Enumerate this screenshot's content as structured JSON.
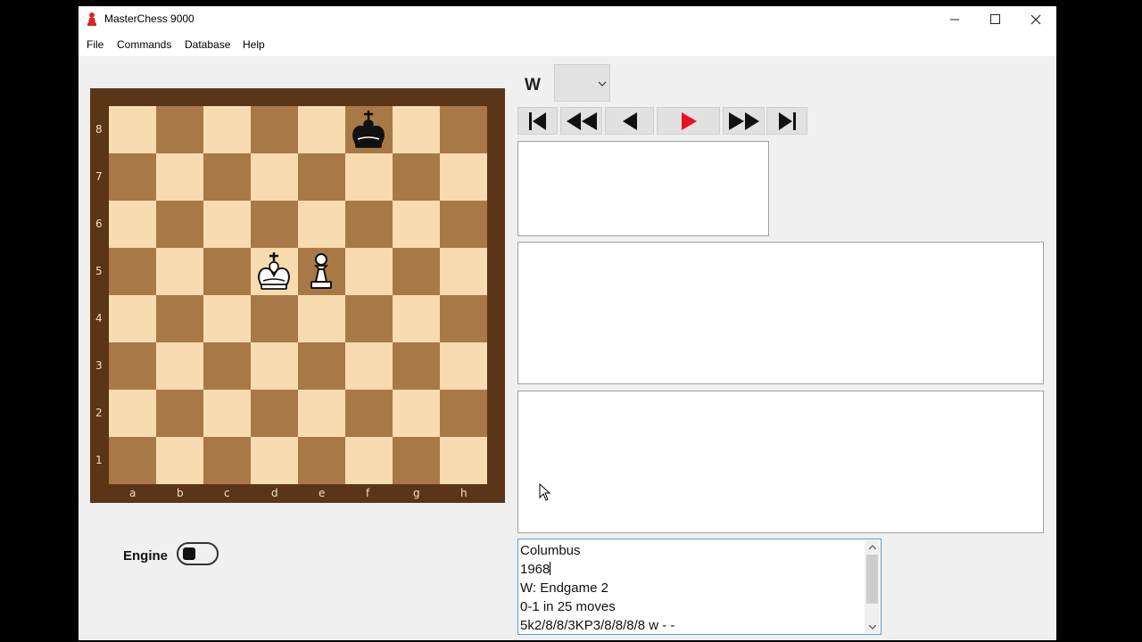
{
  "window": {
    "title": "MasterChess 9000",
    "controls": [
      "minimize",
      "maximize",
      "close"
    ]
  },
  "menu": [
    "File",
    "Commands",
    "Database",
    "Help"
  ],
  "board": {
    "ranks": [
      "8",
      "7",
      "6",
      "5",
      "4",
      "3",
      "2",
      "1"
    ],
    "files": [
      "a",
      "b",
      "c",
      "d",
      "e",
      "f",
      "g",
      "h"
    ],
    "colors": {
      "light": "#f6dcae",
      "dark": "#a87947",
      "frame": "#5a3518"
    },
    "pieces": [
      {
        "square": "f8",
        "piece": "king",
        "color": "black"
      },
      {
        "square": "d5",
        "piece": "king",
        "color": "white"
      },
      {
        "square": "e5",
        "piece": "pawn",
        "color": "white"
      }
    ]
  },
  "side_to_move": {
    "label": "W",
    "selected": ""
  },
  "nav_buttons": [
    {
      "name": "first-move-button",
      "icon": "skip-to-start-icon"
    },
    {
      "name": "back-5-button",
      "icon": "fast-rewind-icon"
    },
    {
      "name": "back-button",
      "icon": "step-back-icon"
    },
    {
      "name": "play-button",
      "icon": "play-icon",
      "color": "#e81123"
    },
    {
      "name": "forward-5-button",
      "icon": "fast-forward-icon"
    },
    {
      "name": "last-move-button",
      "icon": "skip-to-end-icon"
    }
  ],
  "engine": {
    "label": "Engine",
    "enabled": false
  },
  "game_info": {
    "lines": [
      "Columbus",
      "1968",
      "W: Endgame 2",
      "0-1 in 25 moves",
      "5k2/8/8/3KP3/8/8/8/8 w - -"
    ]
  }
}
